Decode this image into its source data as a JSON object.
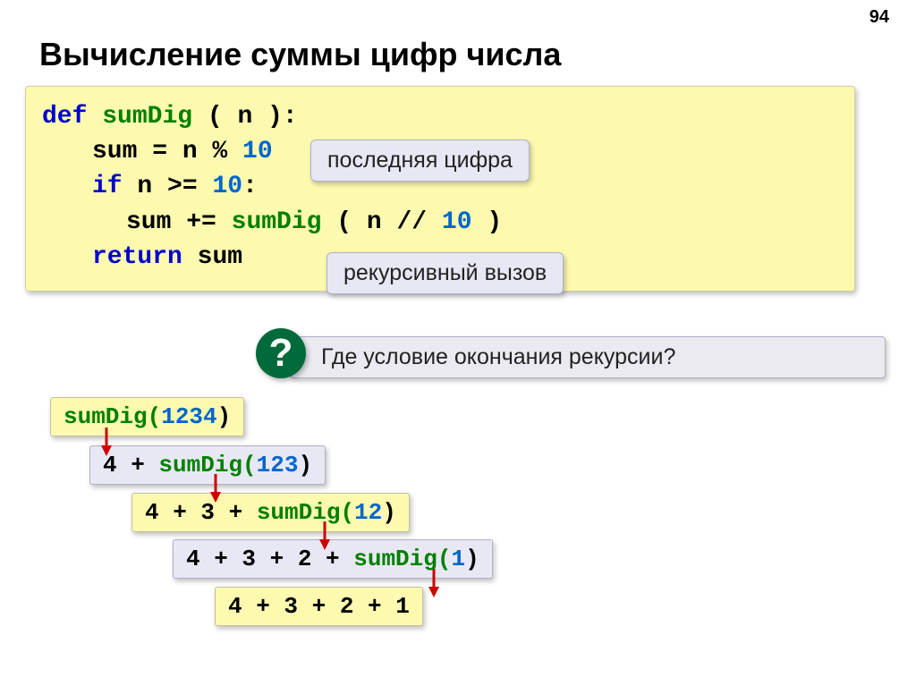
{
  "page_number": "94",
  "title": "Вычисление суммы цифр числа",
  "code": {
    "l1_def": "def",
    "l1_fn": "sumDig",
    "l1_par": "( n ):",
    "l2_a": "sum = n %",
    "l2_b": "10",
    "l3_if": "if",
    "l3_a": "n >=",
    "l3_b": "10",
    "l3_c": ":",
    "l4_a": "sum +=",
    "l4_fn": "sumDig",
    "l4_b": "( n //",
    "l4_c": "10",
    "l4_d": ")",
    "l5_ret": "return",
    "l5_a": "sum"
  },
  "callout1": "последняя цифра",
  "callout2": "рекурсивный вызов",
  "question_mark": "?",
  "question_text": "Где условие окончания рекурсии?",
  "stack": {
    "s1_fn": "sumDig(",
    "s1_arg": "1234",
    "s1_close": ")",
    "s2_pre": "4 + ",
    "s2_fn": "sumDig(",
    "s2_arg": "123",
    "s2_close": ")",
    "s3_pre": "4 + 3 + ",
    "s3_fn": "sumDig(",
    "s3_arg": "12",
    "s3_close": ")",
    "s4_pre": "4 + 3 + 2 + ",
    "s4_fn": "sumDig(",
    "s4_arg": "1",
    "s4_close": ")",
    "s5": "4 + 3 + 2 + 1"
  }
}
